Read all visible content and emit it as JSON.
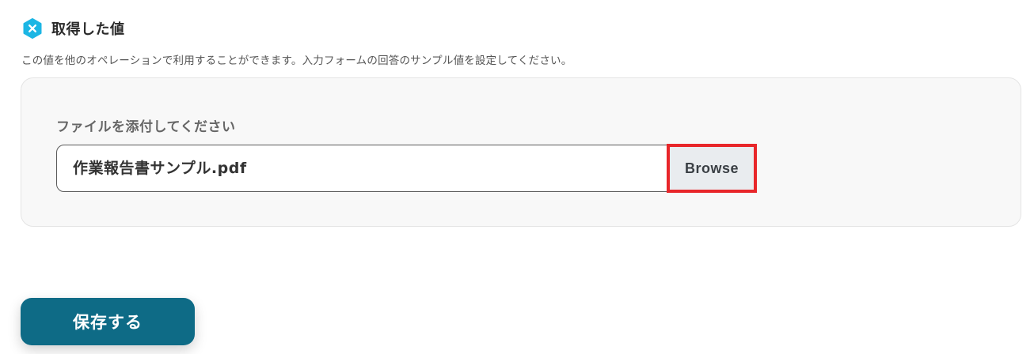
{
  "section": {
    "icon": "x-hexagon-icon",
    "icon_color": "#1cb6e4",
    "title": "取得した値",
    "description": "この値を他のオペレーションで利用することができます。入力フォームの回答のサンプル値を設定してください。"
  },
  "field": {
    "label": "ファイルを添付してください",
    "file_name": "作業報告書サンプル.pdf",
    "browse_label": "Browse",
    "highlight_color": "#e8262a"
  },
  "footer": {
    "save_label": "保存する",
    "save_color": "#0e6b86"
  }
}
